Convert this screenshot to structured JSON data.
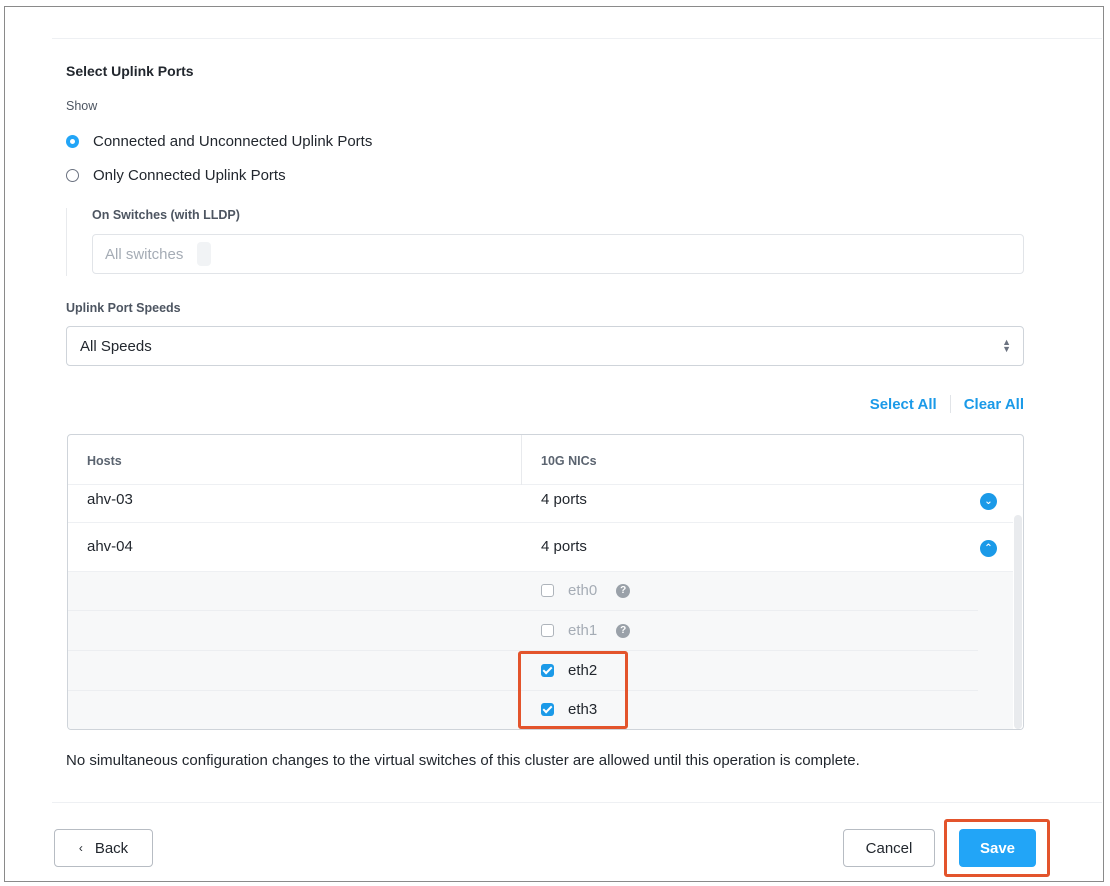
{
  "uplink": {
    "title": "Select Uplink Ports",
    "show_label": "Show",
    "options": [
      {
        "label": "Connected and Unconnected Uplink Ports",
        "selected": true
      },
      {
        "label": "Only Connected Uplink Ports",
        "selected": false
      }
    ],
    "switches_label": "On Switches (with LLDP)",
    "switches_placeholder": "All switches"
  },
  "speeds": {
    "label": "Uplink Port Speeds",
    "selected": "All Speeds"
  },
  "links": {
    "select_all": "Select All",
    "clear_all": "Clear All"
  },
  "table": {
    "headers": [
      "Hosts",
      "10G NICs"
    ],
    "rows": [
      {
        "host": "ahv-03",
        "ports": "4 ports",
        "expanded": false
      },
      {
        "host": "ahv-04",
        "ports": "4 ports",
        "expanded": true
      }
    ],
    "nics": [
      {
        "name": "eth0",
        "checked": false,
        "enabled": false,
        "help_icon": "question-circle-icon"
      },
      {
        "name": "eth1",
        "checked": false,
        "enabled": false,
        "help_icon": "question-circle-icon"
      },
      {
        "name": "eth2",
        "checked": true,
        "enabled": true
      },
      {
        "name": "eth3",
        "checked": true,
        "enabled": true
      }
    ]
  },
  "notice": "No simultaneous configuration changes to the virtual switches of this cluster are allowed until this operation is complete.",
  "footer": {
    "back": "Back",
    "cancel": "Cancel",
    "save": "Save"
  },
  "colors": {
    "accent": "#22a5f7",
    "link": "#1b9ae8",
    "highlight": "#e3542c"
  }
}
